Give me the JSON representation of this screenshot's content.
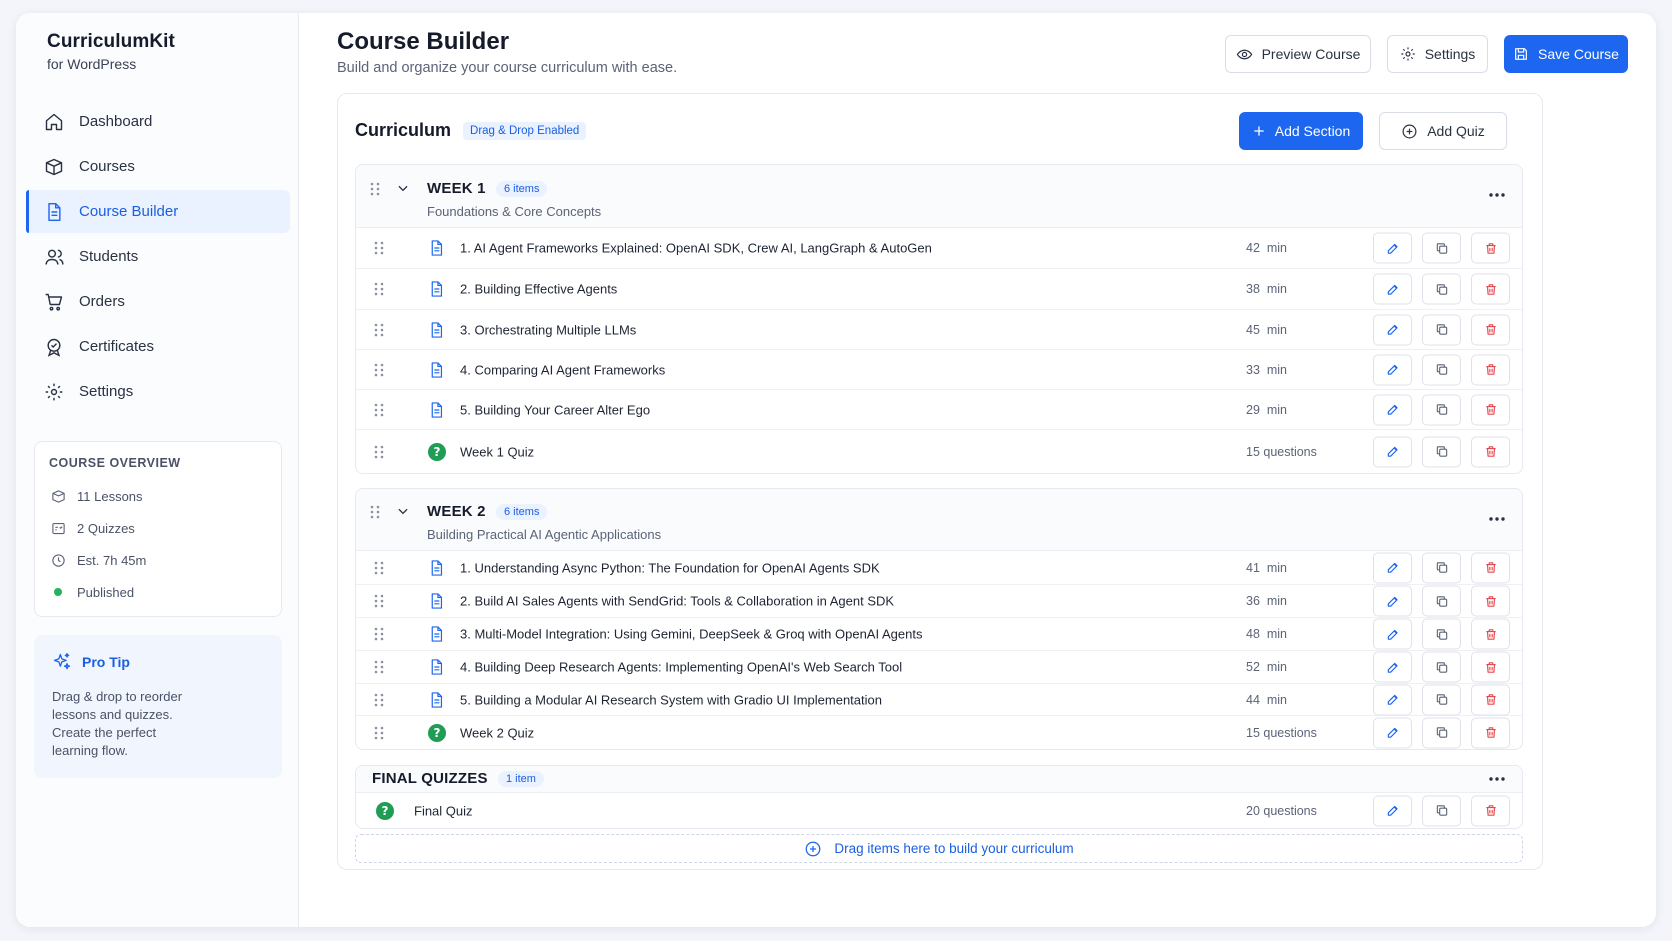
{
  "brand": {
    "title": "CurriculumKit",
    "subtitle": "for WordPress"
  },
  "nav": [
    {
      "label": "Dashboard",
      "icon": "home-icon",
      "active": false
    },
    {
      "label": "Courses",
      "icon": "box-icon",
      "active": false
    },
    {
      "label": "Course Builder",
      "icon": "document-icon",
      "active": true
    },
    {
      "label": "Students",
      "icon": "users-icon",
      "active": false
    },
    {
      "label": "Orders",
      "icon": "cart-icon",
      "active": false
    },
    {
      "label": "Certificates",
      "icon": "certificate-icon",
      "active": false
    },
    {
      "label": "Settings",
      "icon": "gear-icon",
      "active": false
    }
  ],
  "overview": {
    "title": "COURSE OVERVIEW",
    "lessons": "11 Lessons",
    "quizzes": "2 Quizzes",
    "estimate": "Est. 7h 45m",
    "status": "Published"
  },
  "tip": {
    "title": "Pro Tip",
    "body": "Drag & drop to reorder lessons and quizzes. Create the perfect learning flow."
  },
  "header": {
    "title": "Course Builder",
    "subtitle": "Build and organize your course curriculum with ease.",
    "preview_label": "Preview Course",
    "settings_label": "Settings",
    "save_label": "Save Course"
  },
  "curriculum": {
    "title": "Curriculum",
    "badge": "Drag & Drop Enabled",
    "add_section_label": "Add Section",
    "add_quiz_label": "Add Quiz",
    "dropzone_label": "Drag items here to build your curriculum"
  },
  "sections": [
    {
      "title": "WEEK 1",
      "count": "6 items",
      "subtitle": "Foundations & Core Concepts",
      "items": [
        {
          "type": "lesson",
          "title": "1. AI Agent Frameworks Explained: OpenAI SDK, Crew AI, LangGraph & AutoGen",
          "meta": "42  min"
        },
        {
          "type": "lesson",
          "title": "2. Building Effective Agents",
          "meta": "38  min"
        },
        {
          "type": "lesson",
          "title": "3. Orchestrating Multiple LLMs",
          "meta": "45  min"
        },
        {
          "type": "lesson",
          "title": "4. Comparing AI Agent Frameworks",
          "meta": "33  min"
        },
        {
          "type": "lesson",
          "title": "5. Building Your Career Alter Ego",
          "meta": "29  min"
        },
        {
          "type": "quiz",
          "title": "Week 1 Quiz",
          "meta": "15 questions"
        }
      ]
    },
    {
      "title": "WEEK 2",
      "count": "6 items",
      "subtitle": "Building Practical AI Agentic Applications",
      "items": [
        {
          "type": "lesson",
          "title": "1. Understanding Async Python: The Foundation for OpenAI Agents SDK",
          "meta": "41  min"
        },
        {
          "type": "lesson",
          "title": "2. Build AI Sales Agents with SendGrid: Tools & Collaboration in Agent SDK",
          "meta": "36  min"
        },
        {
          "type": "lesson",
          "title": "3. Multi-Model Integration: Using Gemini, DeepSeek & Groq with OpenAI Agents",
          "meta": "48  min"
        },
        {
          "type": "lesson",
          "title": "4. Building Deep Research Agents: Implementing OpenAI's Web Search Tool",
          "meta": "52  min"
        },
        {
          "type": "lesson",
          "title": "5. Building a Modular AI Research System with Gradio UI Implementation",
          "meta": "44  min"
        },
        {
          "type": "quiz",
          "title": "Week 2 Quiz",
          "meta": "15 questions"
        }
      ]
    },
    {
      "title": "FINAL QUIZZES",
      "count": "1 item",
      "subtitle": "",
      "items": [
        {
          "type": "quiz",
          "title": "Final Quiz",
          "meta": "20 questions"
        }
      ]
    }
  ],
  "colors": {
    "accent": "#1d66f0",
    "delete": "#e5484d",
    "quiz": "#1f9d55",
    "published": "#22b45b"
  }
}
